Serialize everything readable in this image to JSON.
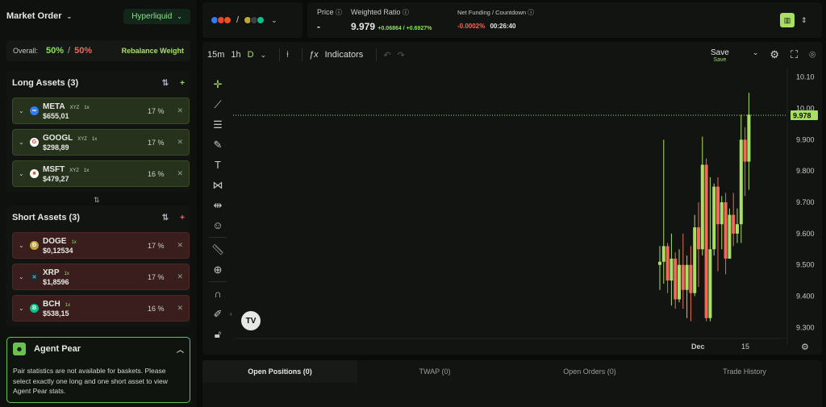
{
  "header": {
    "title": "Market Order",
    "network": "Hyperliquid"
  },
  "overall": {
    "label": "Overall:",
    "long_pct": "50%",
    "sep": "/",
    "short_pct": "50%",
    "rebalance": "Rebalance Weight"
  },
  "long": {
    "title": "Long Assets (3)",
    "items": [
      {
        "symbol": "META",
        "tag": "XYZ",
        "lev": "1x",
        "price": "$655,01",
        "pct": "17 %",
        "icon_color": "#2f7cf6",
        "icon": "∞"
      },
      {
        "symbol": "GOOGL",
        "tag": "XYZ",
        "lev": "1x",
        "price": "$298,89",
        "pct": "17 %",
        "icon_color": "#ffffff",
        "icon": "G"
      },
      {
        "symbol": "MSFT",
        "tag": "XYZ",
        "lev": "1x",
        "price": "$479,27",
        "pct": "16 %",
        "icon_color": "#f25022",
        "icon": "■"
      }
    ]
  },
  "short": {
    "title": "Short Assets (3)",
    "items": [
      {
        "symbol": "DOGE",
        "lev": "1x",
        "price": "$0,12534",
        "pct": "17 %",
        "icon_color": "#c2a633",
        "icon": "Ð"
      },
      {
        "symbol": "XRP",
        "lev": "1x",
        "price": "$1,8596",
        "pct": "17 %",
        "icon_color": "#1e2a2a",
        "icon": "✕"
      },
      {
        "symbol": "BCH",
        "lev": "1x",
        "price": "$538,15",
        "pct": "16 %",
        "icon_color": "#0ac18e",
        "icon": "B"
      }
    ]
  },
  "agent": {
    "title": "Agent Pear",
    "message": "Pair statistics are not available for baskets. Please select exactly one long and one short asset to view Agent Pear stats."
  },
  "topbar": {
    "price_label": "Price",
    "price_value": "-",
    "ratio_label": "Weighted Ratio",
    "ratio_value": "9.979",
    "ratio_change": "+0.06864 / +0.6927%",
    "funding_label": "Net Funding / Countdown",
    "funding_value": "-0.0002%",
    "countdown": "00:26:40"
  },
  "chart_toolbar": {
    "tf_15m": "15m",
    "tf_1h": "1h",
    "tf_d": "D",
    "indicators": "Indicators",
    "save": "Save",
    "save_sub": "Save"
  },
  "chart_data": {
    "type": "candlestick",
    "y_ticks": [
      "10.10",
      "10.00",
      "9.900",
      "9.800",
      "9.700",
      "9.600",
      "9.500",
      "9.400",
      "9.300"
    ],
    "ylim": [
      9.27,
      10.13
    ],
    "x_ticks": [
      "Dec",
      "15"
    ],
    "last_price": "9.978",
    "candles": [
      {
        "o": 9.5,
        "c": 9.51,
        "h": 9.56,
        "l": 9.42
      },
      {
        "o": 9.51,
        "c": 9.56,
        "h": 9.9,
        "l": 9.44
      },
      {
        "o": 9.56,
        "c": 9.45,
        "h": 9.57,
        "l": 9.41
      },
      {
        "o": 9.45,
        "c": 9.52,
        "h": 9.6,
        "l": 9.37
      },
      {
        "o": 9.52,
        "c": 9.39,
        "h": 9.54,
        "l": 9.36
      },
      {
        "o": 9.39,
        "c": 9.5,
        "h": 9.55,
        "l": 9.38
      },
      {
        "o": 9.5,
        "c": 9.42,
        "h": 9.6,
        "l": 9.36
      },
      {
        "o": 9.42,
        "c": 9.5,
        "h": 9.53,
        "l": 9.33
      },
      {
        "o": 9.5,
        "c": 9.41,
        "h": 9.56,
        "l": 9.32
      },
      {
        "o": 9.41,
        "c": 9.62,
        "h": 9.66,
        "l": 9.4
      },
      {
        "o": 9.62,
        "c": 9.55,
        "h": 9.7,
        "l": 9.43
      },
      {
        "o": 9.55,
        "c": 9.82,
        "h": 9.91,
        "l": 9.53
      },
      {
        "o": 9.82,
        "c": 9.33,
        "h": 9.84,
        "l": 9.32
      },
      {
        "o": 9.33,
        "c": 9.55,
        "h": 9.78,
        "l": 9.32
      },
      {
        "o": 9.55,
        "c": 9.75,
        "h": 9.76,
        "l": 9.53
      },
      {
        "o": 9.75,
        "c": 9.63,
        "h": 9.78,
        "l": 9.48
      },
      {
        "o": 9.63,
        "c": 9.7,
        "h": 9.72,
        "l": 9.55
      },
      {
        "o": 9.7,
        "c": 9.52,
        "h": 9.73,
        "l": 9.47
      },
      {
        "o": 9.52,
        "c": 9.66,
        "h": 9.68,
        "l": 9.52
      },
      {
        "o": 9.66,
        "c": 9.6,
        "h": 9.73,
        "l": 9.56
      },
      {
        "o": 9.6,
        "c": 9.63,
        "h": 9.68,
        "l": 9.57
      },
      {
        "o": 9.63,
        "c": 9.9,
        "h": 9.98,
        "l": 9.57
      },
      {
        "o": 9.9,
        "c": 9.83,
        "h": 9.94,
        "l": 9.72
      },
      {
        "o": 9.83,
        "c": 9.98,
        "h": 10.05,
        "l": 9.74
      }
    ]
  },
  "bottom_tabs": [
    "Open Positions (0)",
    "TWAP (0)",
    "Open Orders (0)",
    "Trade History"
  ],
  "colors": {
    "up": "#a8e063",
    "down": "#f0695a",
    "accent": "#a8e063"
  }
}
